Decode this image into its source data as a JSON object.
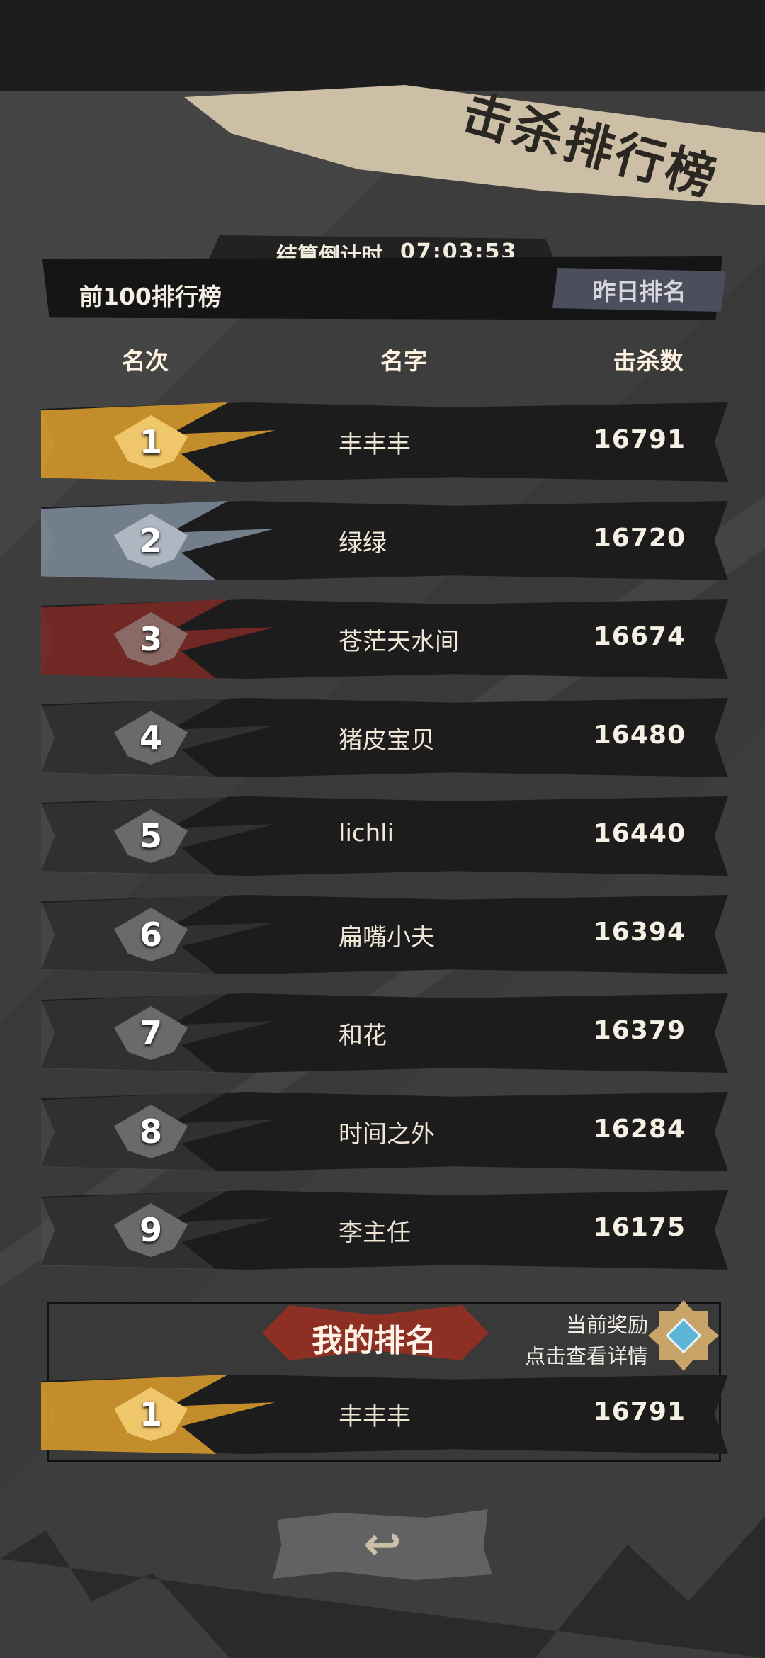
{
  "title": "击杀排行榜",
  "countdown": {
    "label": "结算倒计时",
    "time": "07:03:53"
  },
  "subheader": {
    "title": "前100排行榜",
    "yesterday_button": "昨日排名"
  },
  "columns": {
    "rank": "名次",
    "name": "名字",
    "kills": "击杀数"
  },
  "rows": [
    {
      "rank": "1",
      "name": "丰丰丰",
      "kills": "16791",
      "tier": "gold"
    },
    {
      "rank": "2",
      "name": "绿绿",
      "kills": "16720",
      "tier": "silver"
    },
    {
      "rank": "3",
      "name": "苍茫天水间",
      "kills": "16674",
      "tier": "bronze"
    },
    {
      "rank": "4",
      "name": "猪皮宝贝",
      "kills": "16480",
      "tier": "normal"
    },
    {
      "rank": "5",
      "name": "lichli",
      "kills": "16440",
      "tier": "normal"
    },
    {
      "rank": "6",
      "name": "扁嘴小夫",
      "kills": "16394",
      "tier": "normal"
    },
    {
      "rank": "7",
      "name": "和花",
      "kills": "16379",
      "tier": "normal"
    },
    {
      "rank": "8",
      "name": "时间之外",
      "kills": "16284",
      "tier": "normal"
    },
    {
      "rank": "9",
      "name": "李主任",
      "kills": "16175",
      "tier": "normal"
    }
  ],
  "my_rank": {
    "title": "我的排名",
    "reward_line1": "当前奖励",
    "reward_line2": "点击查看详情",
    "rank": "1",
    "name": "丰丰丰",
    "kills": "16791",
    "tier": "gold"
  },
  "colors": {
    "gold": "#d79a2e",
    "silver": "#7d8a99",
    "bronze": "#7a2a26",
    "normal": "#555555",
    "accent_red": "#8e2f24"
  },
  "icons": {
    "back": "back-arrow-icon",
    "reward": "reward-badge-icon"
  }
}
